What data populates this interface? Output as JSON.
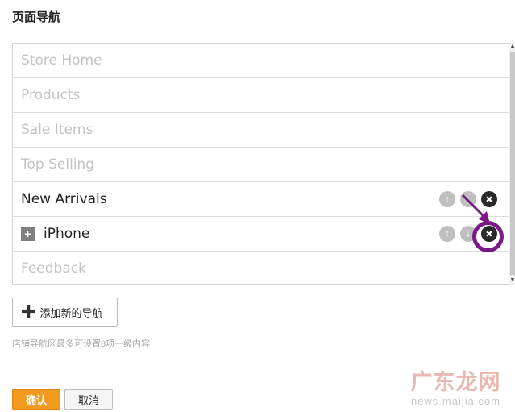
{
  "page": {
    "title": "页面导航"
  },
  "nav_items": [
    {
      "label": "Store Home",
      "state": "disabled"
    },
    {
      "label": "Products",
      "state": "disabled"
    },
    {
      "label": "Sale Items",
      "state": "disabled"
    },
    {
      "label": "Top Selling",
      "state": "disabled"
    },
    {
      "label": "New Arrivals",
      "state": "active"
    },
    {
      "label": "iPhone",
      "state": "active",
      "expand_symbol": "+"
    },
    {
      "label": "Feedback",
      "state": "disabled"
    }
  ],
  "row_actions": {
    "up_icon": "↑",
    "down_icon": "↓",
    "delete_icon": "✖"
  },
  "add_button": {
    "icon": "✚",
    "label": "添加新的导航"
  },
  "hint": "店铺导航区最多可设置8项一级内容",
  "footer": {
    "confirm": "确认",
    "cancel": "取消"
  },
  "watermark": {
    "cn": "广东龙网",
    "url": "news.maijia.com"
  },
  "colors": {
    "confirm_bg": "#f19a1e",
    "annotation": "#7b1a86",
    "disabled_text": "#c3c3c3"
  }
}
